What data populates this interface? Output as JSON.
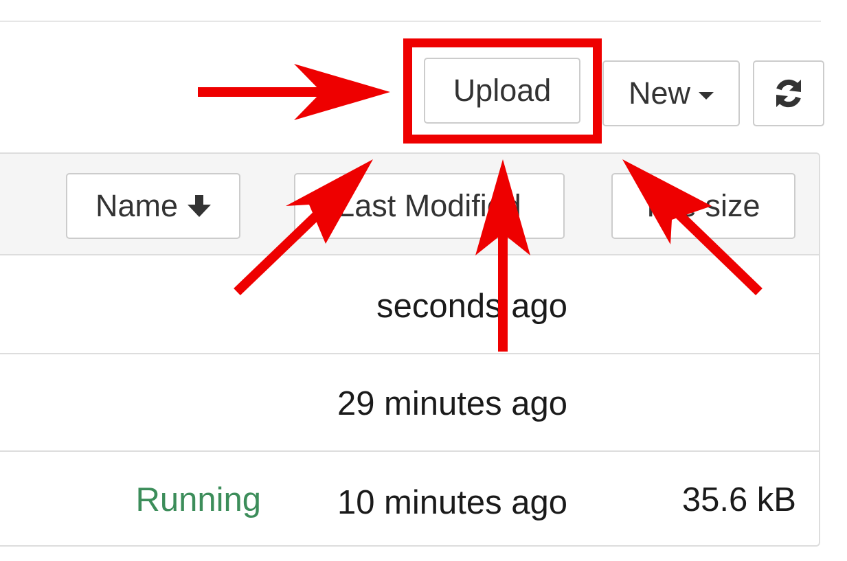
{
  "toolbar": {
    "upload_label": "Upload",
    "new_label": "New",
    "refresh_icon": "refresh-icon"
  },
  "table": {
    "sort_buttons": [
      {
        "label": "Name",
        "icon": "arrow-down-icon"
      },
      {
        "label": "Last Modified"
      },
      {
        "label": "File size"
      }
    ],
    "rows": [
      {
        "status": "",
        "modified": "seconds ago",
        "size": ""
      },
      {
        "status": "",
        "modified": "29 minutes ago",
        "size": ""
      },
      {
        "status": "Running",
        "modified": "10 minutes ago",
        "size": "35.6 kB"
      }
    ]
  },
  "annotation": {
    "highlight_color": "#ee0000",
    "status_running_color": "#3c8d5a"
  }
}
